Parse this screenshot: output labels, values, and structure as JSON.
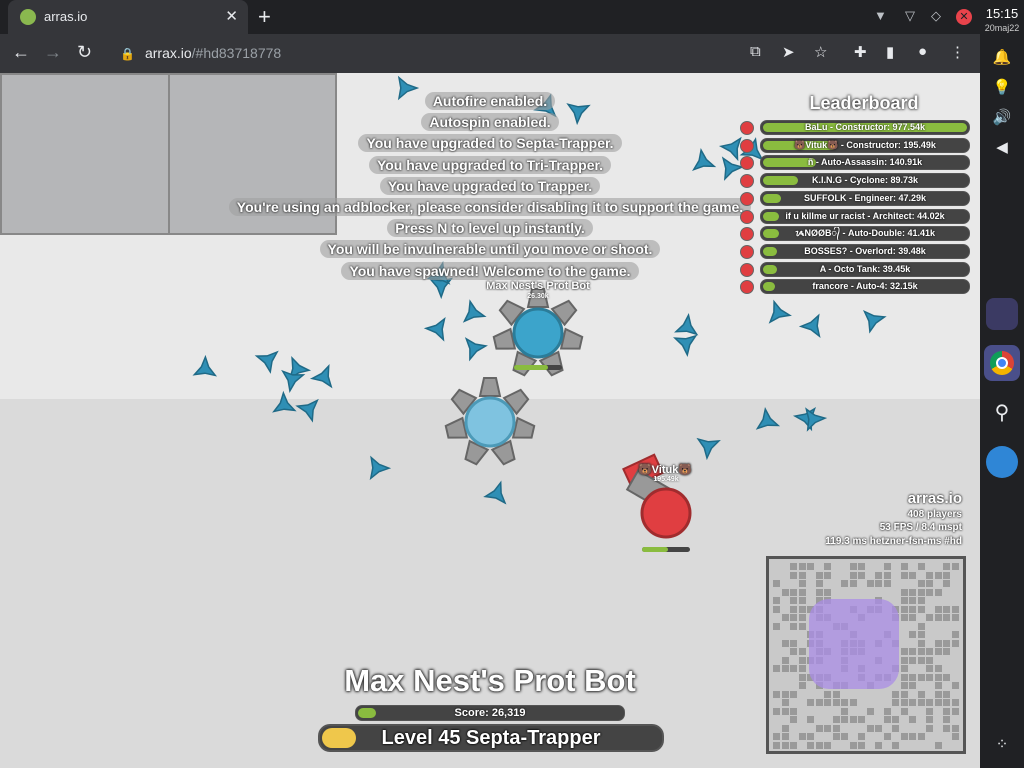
{
  "browser": {
    "tab_title": "arras.io",
    "url_host": "arrax.io",
    "url_hash": "/#hd83718778",
    "clock": "15:15",
    "date": "20maj22"
  },
  "messages": [
    "Autofire enabled.",
    "Autospin enabled.",
    "You have upgraded to Septa-Trapper.",
    "You have upgraded to Tri-Trapper.",
    "You have upgraded to Trapper.",
    "You're using an adblocker, please consider disabling it to support the game.",
    "Press N to level up instantly.",
    "You will be invulnerable until you move or shoot.",
    "You have spawned! Welcome to the game."
  ],
  "leaderboard": {
    "title": "Leaderboard",
    "entries": [
      {
        "label": "BaLu - Constructor: 977.54k",
        "fraction": 1.0
      },
      {
        "label": "🐻Vituk🐻 - Constructor: 195.49k",
        "fraction": 0.36
      },
      {
        "label": "ñ - Auto-Assassin: 140.91k",
        "fraction": 0.26
      },
      {
        "label": "K.I.N.G - Cyclone: 89.73k",
        "fraction": 0.17
      },
      {
        "label": "SUFFOLK - Engineer: 47.29k",
        "fraction": 0.09
      },
      {
        "label": "if u killme ur racist - Architect: 44.02k",
        "fraction": 0.08
      },
      {
        "label": "ᝰNØØB᭄ - Auto-Double: 41.41k",
        "fraction": 0.08
      },
      {
        "label": "BOSSES? - Overlord: 39.48k",
        "fraction": 0.07
      },
      {
        "label": "A - Octo Tank: 39.45k",
        "fraction": 0.07
      },
      {
        "label": "francore - Auto-4: 32.15k",
        "fraction": 0.06
      }
    ]
  },
  "players": {
    "bot_name": "Max Nest's Prot Bot",
    "bot_score": "26.30k",
    "enemy_name": "🐻Vituk🐻",
    "enemy_score": "195.49k"
  },
  "server_info": {
    "title": "arras.io",
    "players": "408 players",
    "perf": "53 FPS / 8.4 mspt",
    "ping": "119.3 ms  hetzner-fsn-ms #hd"
  },
  "hud": {
    "name": "Max Nest's Prot Bot",
    "score_label": "Score: 26,319",
    "score_fraction": 0.07,
    "level_label": "Level 45 Septa-Trapper",
    "level_fraction": 0.1
  },
  "colors": {
    "player_blue": "#3ca4cb",
    "enemy_red": "#e03e41",
    "trap_blue": "#2f8fb5",
    "health_green": "#8abc3f",
    "level_yellow": "#efc74b"
  }
}
